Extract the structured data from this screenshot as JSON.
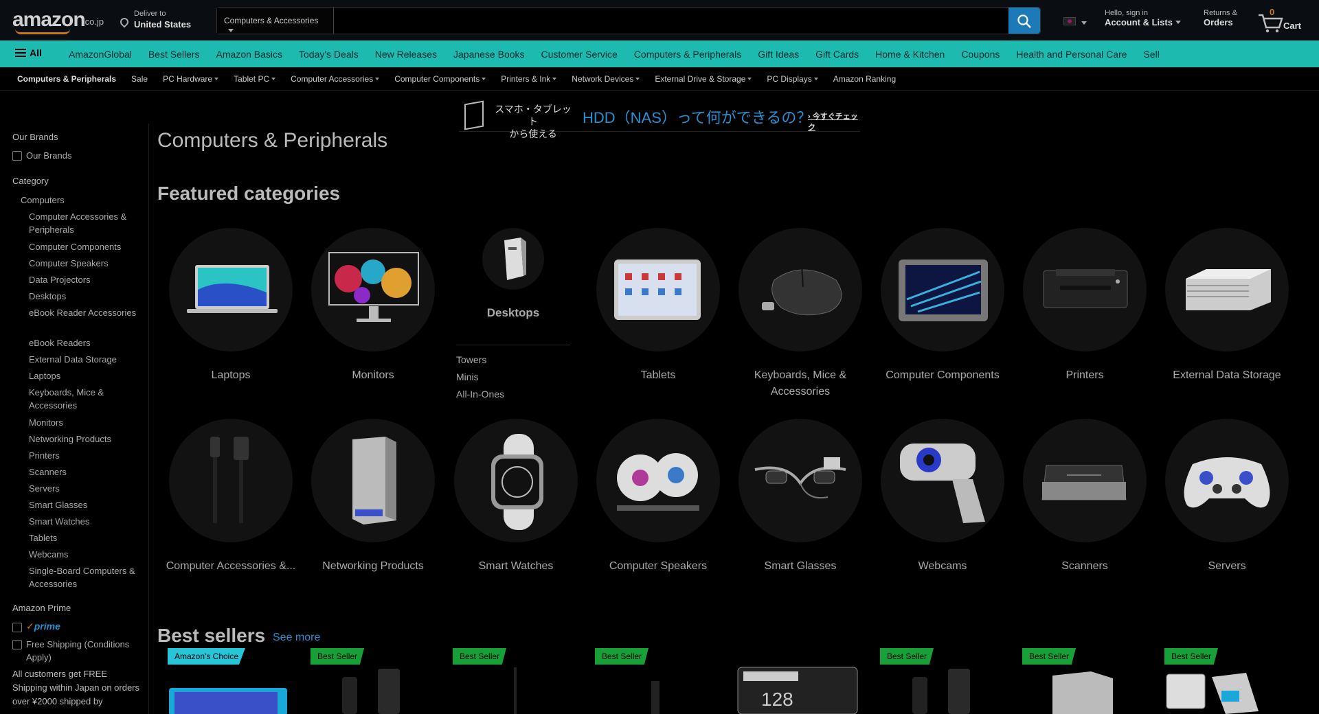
{
  "header": {
    "logo_text": "amazon",
    "logo_tld": ".co.jp",
    "deliver_line1": "Deliver to",
    "deliver_line2": "United States",
    "search_category": "Computers & Accessories",
    "search_placeholder": "",
    "account_line1": "Hello, sign in",
    "account_line2": "Account & Lists",
    "returns_line1": "Returns &",
    "returns_line2": "Orders",
    "cart_count": "0",
    "cart_label": "Cart"
  },
  "nav": {
    "all_label": "All",
    "items": [
      "AmazonGlobal",
      "Best Sellers",
      "Amazon Basics",
      "Today's Deals",
      "New Releases",
      "Japanese Books",
      "Customer Service",
      "Computers & Peripherals",
      "Gift Ideas",
      "Gift Cards",
      "Home & Kitchen",
      "Coupons",
      "Health and Personal Care",
      "Sell"
    ]
  },
  "subnav": {
    "items": [
      "Computers & Peripherals",
      "Sale",
      "PC Hardware",
      "Tablet PC",
      "Computer Accessories",
      "Computer Components",
      "Printers & Ink",
      "Network Devices",
      "External Drive & Storage",
      "PC Displays",
      "Amazon Ranking"
    ]
  },
  "banner": {
    "jp_line1": "スマホ・タブレット",
    "jp_line2": "から使える",
    "main": "HDD（NAS）って何ができるの？",
    "cta": "› 今すぐチェック"
  },
  "sidebar": {
    "our_brands_heading": "Our Brands",
    "our_brands_option": "Our Brands",
    "category_heading": "Category",
    "category_root": "Computers",
    "categories": [
      "Computer Accessories & Peripherals",
      "Computer Components",
      "Computer Speakers",
      "Data Projectors",
      "Desktops",
      "eBook Reader Accessories",
      "eBook Readers",
      "External Data Storage",
      "Laptops",
      "Keyboards, Mice & Accessories",
      "Monitors",
      "Networking Products",
      "Printers",
      "Scanners",
      "Servers",
      "Smart Glasses",
      "Smart Watches",
      "Tablets",
      "Webcams",
      "Single-Board Computers & Accessories"
    ],
    "prime_heading": "Amazon Prime",
    "prime_label": "prime",
    "free_shipping": "Free Shipping (Conditions Apply)",
    "note": "All customers get FREE Shipping within Japan on orders over ¥2000 shipped by"
  },
  "main": {
    "page_title": "Computers & Peripherals",
    "featured_title": "Featured categories",
    "row1": [
      "Laptops",
      "Monitors",
      "Desktops",
      "Tablets",
      "Keyboards, Mice & Accessories",
      "Computer Components",
      "Printers",
      "External Data Storage"
    ],
    "desktops_sub": [
      "Towers",
      "Minis",
      "All-In-Ones"
    ],
    "row2": [
      "Computer Accessories &...",
      "Networking Products",
      "Smart Watches",
      "Computer Speakers",
      "Smart Glasses",
      "Webcams",
      "Scanners",
      "Servers"
    ],
    "bestsellers_title": "Best sellers",
    "see_more": "See more",
    "badges": [
      "Amazon's Choice",
      "Best Seller",
      "Best Seller",
      "Best Seller",
      "Best Seller",
      "Best Seller",
      "Best Seller"
    ]
  }
}
